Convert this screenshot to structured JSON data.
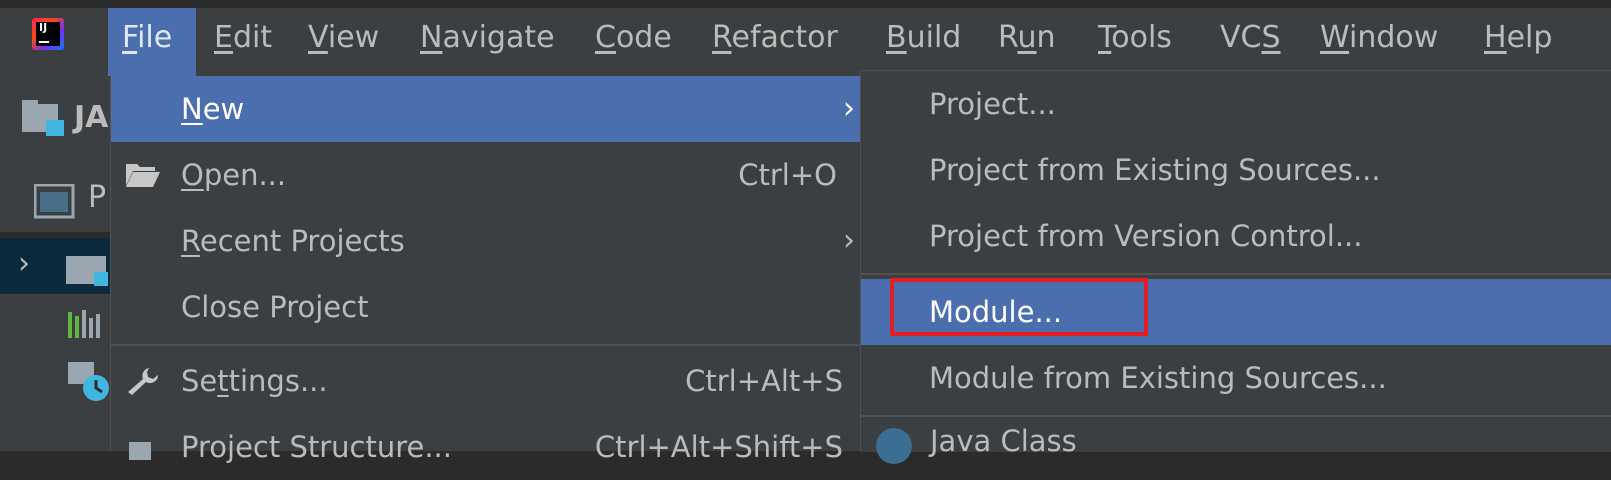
{
  "menubar": {
    "items": [
      {
        "label": "File",
        "mnemonic": "F"
      },
      {
        "label": "Edit",
        "mnemonic": "E"
      },
      {
        "label": "View",
        "mnemonic": "V"
      },
      {
        "label": "Navigate",
        "mnemonic": "N"
      },
      {
        "label": "Code",
        "mnemonic": "C"
      },
      {
        "label": "Refactor",
        "mnemonic": "R"
      },
      {
        "label": "Build",
        "mnemonic": "B"
      },
      {
        "label": "Run",
        "mnemonic": "u"
      },
      {
        "label": "Tools",
        "mnemonic": "T"
      },
      {
        "label": "VCS",
        "mnemonic": "S"
      },
      {
        "label": "Window",
        "mnemonic": "W"
      },
      {
        "label": "Help",
        "mnemonic": "H"
      }
    ],
    "active": "File",
    "logo_text": "IJ"
  },
  "project_panel": {
    "header_text": "JA",
    "row_text": "P"
  },
  "file_menu": {
    "items": [
      {
        "label": "New",
        "shortcut": "",
        "submenu": true,
        "active": true,
        "icon": ""
      },
      {
        "label": "Open...",
        "shortcut": "Ctrl+O",
        "submenu": false,
        "icon": "folder-open-icon"
      },
      {
        "label": "Recent Projects",
        "shortcut": "",
        "submenu": true,
        "icon": ""
      },
      {
        "label": "Close Project",
        "shortcut": "",
        "submenu": false,
        "icon": ""
      },
      {
        "label": "Settings...",
        "shortcut": "Ctrl+Alt+S",
        "submenu": false,
        "icon": "wrench-icon"
      },
      {
        "label": "Project Structure...",
        "shortcut": "Ctrl+Alt+Shift+S",
        "submenu": false,
        "icon": "project-structure-icon"
      }
    ]
  },
  "new_submenu": {
    "items": [
      {
        "label": "Project..."
      },
      {
        "label": "Project from Existing Sources..."
      },
      {
        "label": "Project from Version Control..."
      },
      {
        "label": "Module...",
        "active": true,
        "highlighted": true
      },
      {
        "label": "Module from Existing Sources..."
      },
      {
        "label": "Java Class"
      }
    ]
  },
  "colors": {
    "menu_bg": "#3c3f41",
    "selection": "#4b6eaf",
    "highlight_border": "#e31e24",
    "text": "#bbbbbb"
  }
}
